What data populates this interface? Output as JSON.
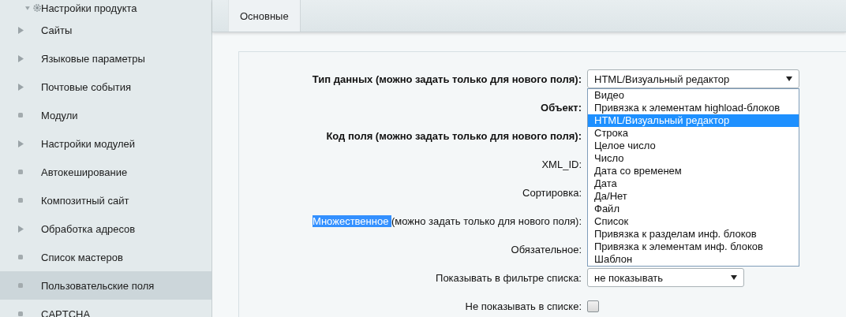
{
  "sidebar": {
    "items": [
      {
        "label": "Настройки продукта",
        "kind": "group",
        "selected": false
      },
      {
        "label": "Сайты",
        "kind": "arrow",
        "selected": false
      },
      {
        "label": "Языковые параметры",
        "kind": "arrow",
        "selected": false
      },
      {
        "label": "Почтовые события",
        "kind": "arrow",
        "selected": false
      },
      {
        "label": "Модули",
        "kind": "dot",
        "selected": false
      },
      {
        "label": "Настройки модулей",
        "kind": "arrow",
        "selected": false
      },
      {
        "label": "Автокеширование",
        "kind": "dot",
        "selected": false
      },
      {
        "label": "Композитный сайт",
        "kind": "dot",
        "selected": false
      },
      {
        "label": "Обработка адресов",
        "kind": "arrow",
        "selected": false
      },
      {
        "label": "Список мастеров",
        "kind": "dot",
        "selected": false
      },
      {
        "label": "Пользовательские поля",
        "kind": "dot",
        "selected": true
      },
      {
        "label": "CAPTCHA",
        "kind": "dot",
        "selected": false
      }
    ]
  },
  "tabs": [
    {
      "label": "Основные",
      "selected": true
    }
  ],
  "form": {
    "rows": [
      {
        "label": "Тип данных (можно задать только для нового поля):",
        "bold": true,
        "kind": "select",
        "value": "HTML/Визуальный редактор",
        "open": true
      },
      {
        "label": "Объект:",
        "bold": true,
        "kind": "hidden"
      },
      {
        "label": "Код поля (можно задать только для нового поля):",
        "bold": true,
        "kind": "hidden"
      },
      {
        "label": "XML_ID:",
        "bold": false,
        "kind": "hidden"
      },
      {
        "label": "Сортировка:",
        "bold": false,
        "kind": "hidden"
      },
      {
        "label": "(можно задать только для нового поля):",
        "selected_text": "Множественное ",
        "bold": false,
        "kind": "hidden"
      },
      {
        "label": "Обязательное:",
        "bold": false,
        "kind": "hidden"
      },
      {
        "label": "Показывать в фильтре списка:",
        "bold": false,
        "kind": "select",
        "value": "не показывать",
        "open": false
      },
      {
        "label": "Не показывать в списке:",
        "bold": false,
        "kind": "checkbox",
        "checked": false
      }
    ]
  },
  "dropdown": {
    "options": [
      {
        "label": "Видео",
        "selected": false
      },
      {
        "label": "Привязка к элементам highload-блоков",
        "selected": false
      },
      {
        "label": "HTML/Визуальный редактор",
        "selected": true
      },
      {
        "label": "Строка",
        "selected": false
      },
      {
        "label": "Целое число",
        "selected": false
      },
      {
        "label": "Число",
        "selected": false
      },
      {
        "label": "Дата со временем",
        "selected": false
      },
      {
        "label": "Дата",
        "selected": false
      },
      {
        "label": "Да/Нет",
        "selected": false
      },
      {
        "label": "Файл",
        "selected": false
      },
      {
        "label": "Список",
        "selected": false
      },
      {
        "label": "Привязка к разделам инф. блоков",
        "selected": false
      },
      {
        "label": "Привязка к элементам инф. блоков",
        "selected": false
      },
      {
        "label": "Шаблон",
        "selected": false
      }
    ]
  }
}
